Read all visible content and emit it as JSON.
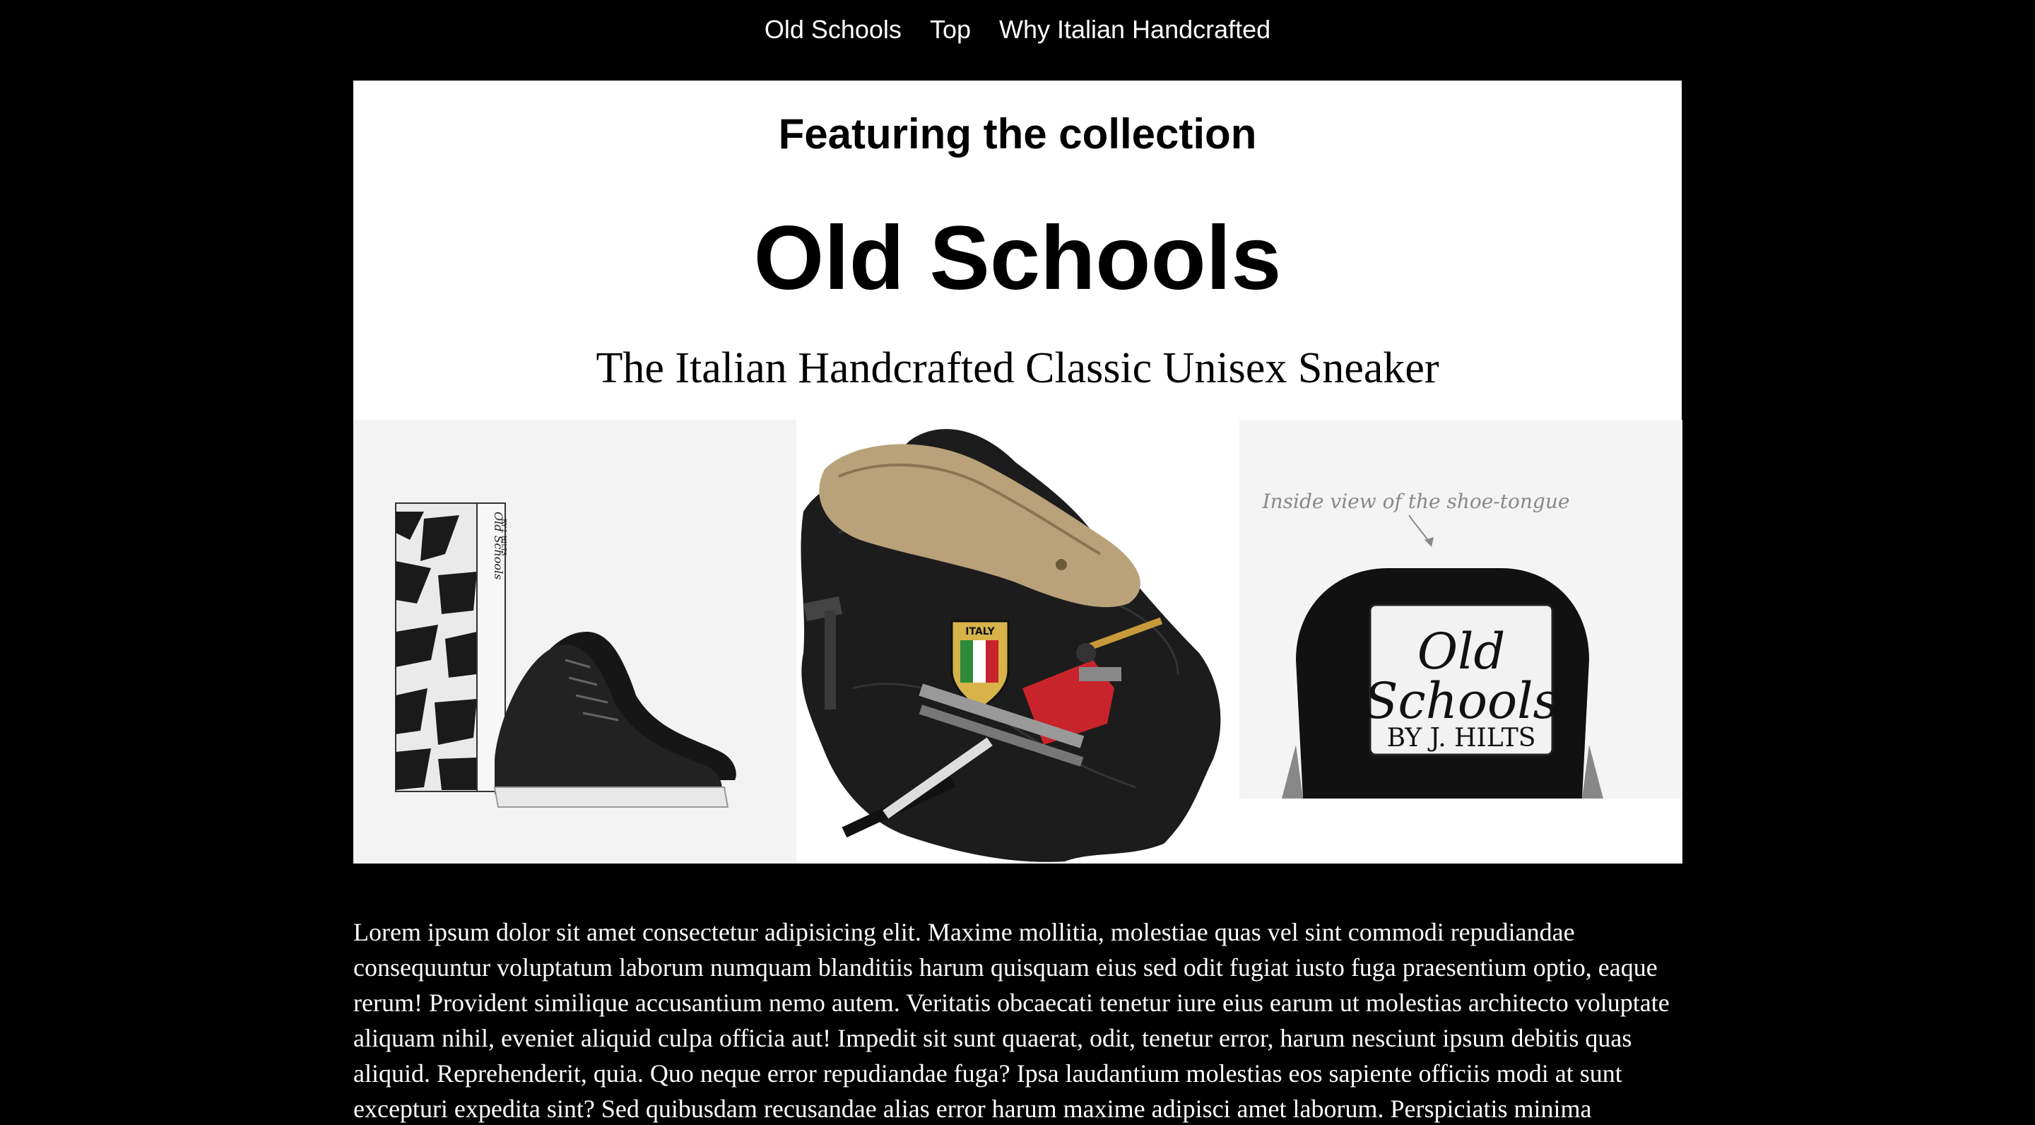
{
  "nav": {
    "items": [
      {
        "label": "Old Schools"
      },
      {
        "label": "Top"
      },
      {
        "label": "Why Italian Handcrafted"
      }
    ]
  },
  "hero": {
    "featuring": "Featuring the collection",
    "title": "Old Schools",
    "subtitle": "The Italian Handcrafted Classic Unisex Sneaker"
  },
  "gallery": {
    "box_label": "Old Schools",
    "box_sublabel": "BY J. HILTS",
    "badge_label": "ITALY",
    "tongue_caption": "Inside view of the shoe-tongue",
    "tongue_label_line1": "Old",
    "tongue_label_line2": "Schools",
    "tongue_label_line3": "BY J. HILTS"
  },
  "article": {
    "body": "Lorem ipsum dolor sit amet consectetur adipisicing elit. Maxime mollitia, molestiae quas vel sint commodi repudiandae consequuntur voluptatum laborum numquam blanditiis harum quisquam eius sed odit fugiat iusto fuga praesentium optio, eaque rerum! Provident similique accusantium nemo autem. Veritatis obcaecati tenetur iure eius earum ut molestias architecto voluptate aliquam nihil, eveniet aliquid culpa officia aut! Impedit sit sunt quaerat, odit, tenetur error, harum nesciunt ipsum debitis quas aliquid. Reprehenderit, quia. Quo neque error repudiandae fuga? Ipsa laudantium molestias eos sapiente officiis modi at sunt excepturi expedita sint? Sed quibusdam recusandae alias error harum maxime adipisci amet laborum. Perspiciatis minima nesciunt dolorem! Officiis iure rerum voluptates a cumque velit quibusdam sed amet tempora."
  },
  "colors": {
    "page_background": "#000000",
    "hero_background": "#ffffff",
    "nav_text": "#ffffff",
    "flag_green": "#2e8b3a",
    "flag_red": "#c8242b"
  }
}
